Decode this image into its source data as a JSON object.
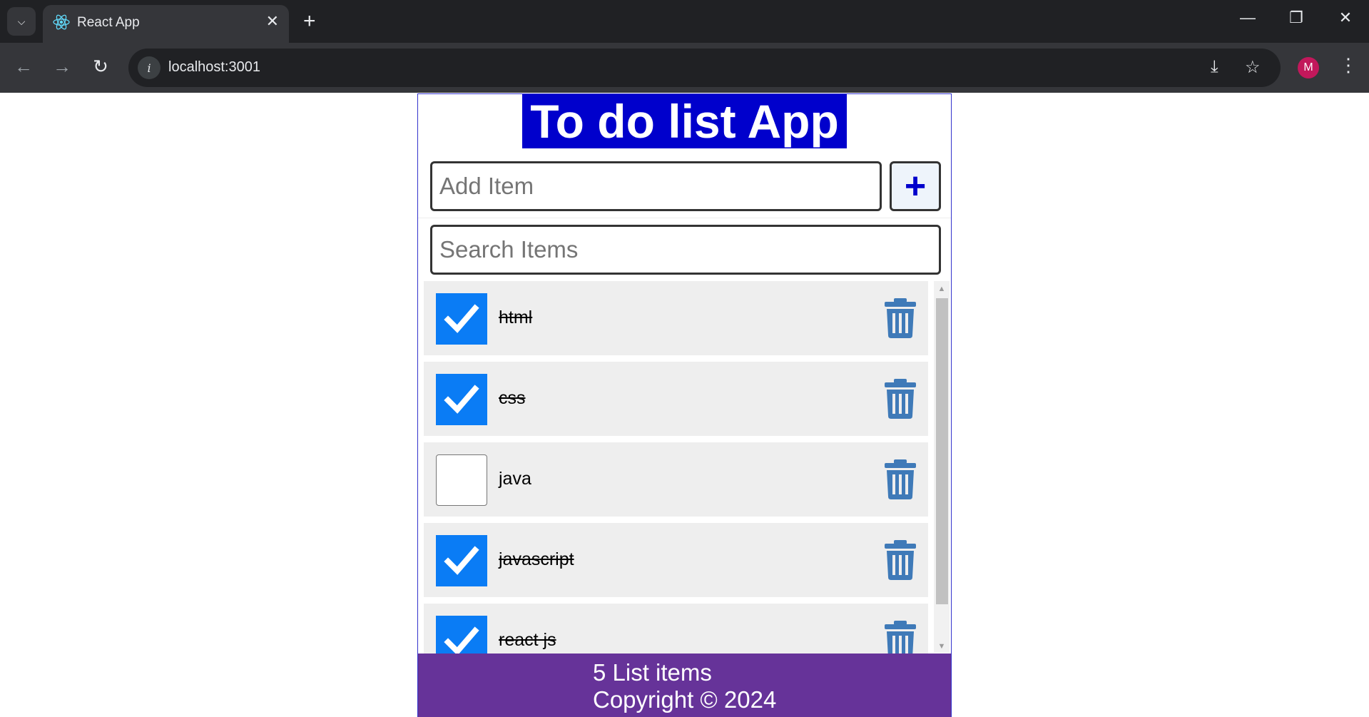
{
  "browser": {
    "tab_title": "React App",
    "url": "localhost:3001",
    "profile_initial": "M"
  },
  "app": {
    "title": "To do list App",
    "add_input": {
      "placeholder": "Add Item",
      "value": ""
    },
    "add_button_label": "+",
    "search_input": {
      "placeholder": "Search Items",
      "value": ""
    },
    "items": [
      {
        "label": "html",
        "checked": true
      },
      {
        "label": "css",
        "checked": true
      },
      {
        "label": "java",
        "checked": false
      },
      {
        "label": "javascript",
        "checked": true
      },
      {
        "label": "react js",
        "checked": true
      }
    ],
    "footer": {
      "count_text": "5 List items",
      "copyright": "Copyright © 2024"
    }
  },
  "colors": {
    "title_bg": "#0000cc",
    "checkbox_checked": "#0a7cf5",
    "trash_icon": "#3f7ab8",
    "footer_bg": "#663399",
    "item_bg": "#eeeeee"
  }
}
